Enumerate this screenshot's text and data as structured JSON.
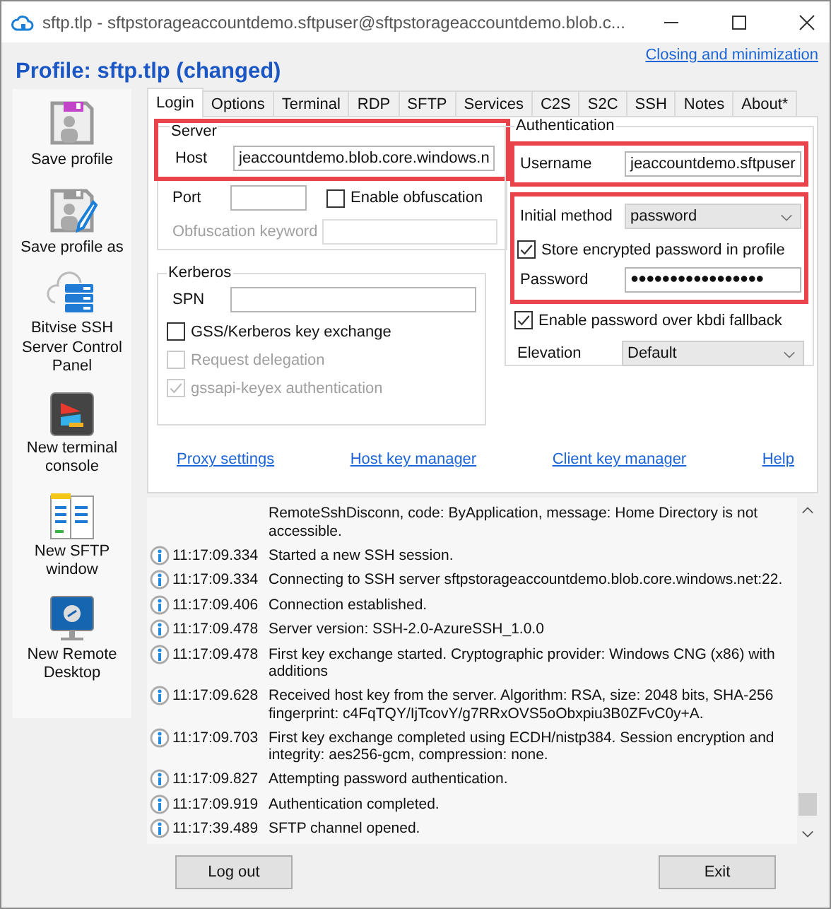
{
  "window": {
    "title": "sftp.tlp - sftpstorageaccountdemo.sftpuser@sftpstorageaccountdemo.blob.c..."
  },
  "profile_title": "Profile: sftp.tlp (changed)",
  "closing_link": "Closing and minimization",
  "sidebar": {
    "items": [
      {
        "label": "Save profile",
        "kind": "save"
      },
      {
        "label": "Save profile as",
        "kind": "saveas"
      },
      {
        "label": "Bitvise SSH Server Control Panel",
        "kind": "server"
      },
      {
        "label": "New terminal console",
        "kind": "terminal"
      },
      {
        "label": "New SFTP window",
        "kind": "sftp"
      },
      {
        "label": "New Remote Desktop",
        "kind": "rdp"
      }
    ]
  },
  "tabs": [
    {
      "label": "Login",
      "selected": true
    },
    {
      "label": "Options",
      "selected": false
    },
    {
      "label": "Terminal",
      "selected": false
    },
    {
      "label": "RDP",
      "selected": false
    },
    {
      "label": "SFTP",
      "selected": false
    },
    {
      "label": "Services",
      "selected": false
    },
    {
      "label": "C2S",
      "selected": false
    },
    {
      "label": "S2C",
      "selected": false
    },
    {
      "label": "SSH",
      "selected": false
    },
    {
      "label": "Notes",
      "selected": false
    },
    {
      "label": "About*",
      "selected": false
    }
  ],
  "server": {
    "title": "Server",
    "host": {
      "label": "Host",
      "value": "jeaccountdemo.blob.core.windows.n",
      "highlighted": true
    },
    "port": {
      "label": "Port"
    },
    "obfuscation": {
      "label": "Enable obfuscation",
      "checked": false
    },
    "obfuscation_keyword": {
      "label": "Obfuscation keyword",
      "disabled": true
    }
  },
  "kerberos": {
    "title": "Kerberos",
    "spn": {
      "label": "SPN"
    },
    "options": [
      {
        "label": "GSS/Kerberos key exchange",
        "checked": false,
        "disabled": false
      },
      {
        "label": "Request delegation",
        "checked": false,
        "disabled": true
      },
      {
        "label": "gssapi-keyex authentication",
        "checked": true,
        "disabled": true
      }
    ]
  },
  "authentication": {
    "title": "Authentication",
    "username": {
      "label": "Username",
      "value": "jeaccountdemo.sftpuser",
      "highlighted": true
    },
    "method_block": {
      "highlighted": true,
      "initial_method": {
        "label": "Initial method",
        "value": "password"
      },
      "store_password": {
        "label": "Store encrypted password in profile",
        "checked": true
      },
      "password": {
        "label": "Password",
        "value": "●●●●●●●●●●●●●●●●●"
      }
    },
    "kbdi_fallback": {
      "label": "Enable password over kbdi fallback",
      "checked": true
    },
    "elevation": {
      "label": "Elevation",
      "value": "Default"
    }
  },
  "links": [
    "Proxy settings",
    "Host key manager",
    "Client key manager",
    "Help"
  ],
  "log": [
    {
      "text": "RemoteSshDisconn, code: ByApplication, message: Home Directory is not accessible."
    },
    {
      "kind": "info",
      "time": "11:17:09.334",
      "text": "Started a new SSH session."
    },
    {
      "kind": "info",
      "time": "11:17:09.334",
      "text": "Connecting to SSH server sftpstorageaccountdemo.blob.core.windows.net:22."
    },
    {
      "kind": "info",
      "time": "11:17:09.406",
      "text": "Connection established."
    },
    {
      "kind": "info",
      "time": "11:17:09.478",
      "text": "Server version: SSH-2.0-AzureSSH_1.0.0"
    },
    {
      "kind": "info",
      "time": "11:17:09.478",
      "text": "First key exchange started. Cryptographic provider: Windows CNG (x86) with additions"
    },
    {
      "kind": "info",
      "time": "11:17:09.628",
      "text": "Received host key from the server. Algorithm: RSA, size: 2048 bits, SHA-256 fingerprint: c4FqTQY/IjTcovY/g7RRxOVS5oObxpiu3B0ZFvC0y+A."
    },
    {
      "kind": "info",
      "time": "11:17:09.703",
      "text": "First key exchange completed using ECDH/nistp384. Session encryption and integrity: aes256-gcm, compression: none."
    },
    {
      "kind": "info",
      "time": "11:17:09.827",
      "text": "Attempting password authentication."
    },
    {
      "kind": "info",
      "time": "11:17:09.919",
      "text": "Authentication completed."
    },
    {
      "kind": "info",
      "time": "11:17:39.489",
      "text": "SFTP channel opened."
    }
  ],
  "buttons": [
    "Log out",
    "Exit"
  ]
}
